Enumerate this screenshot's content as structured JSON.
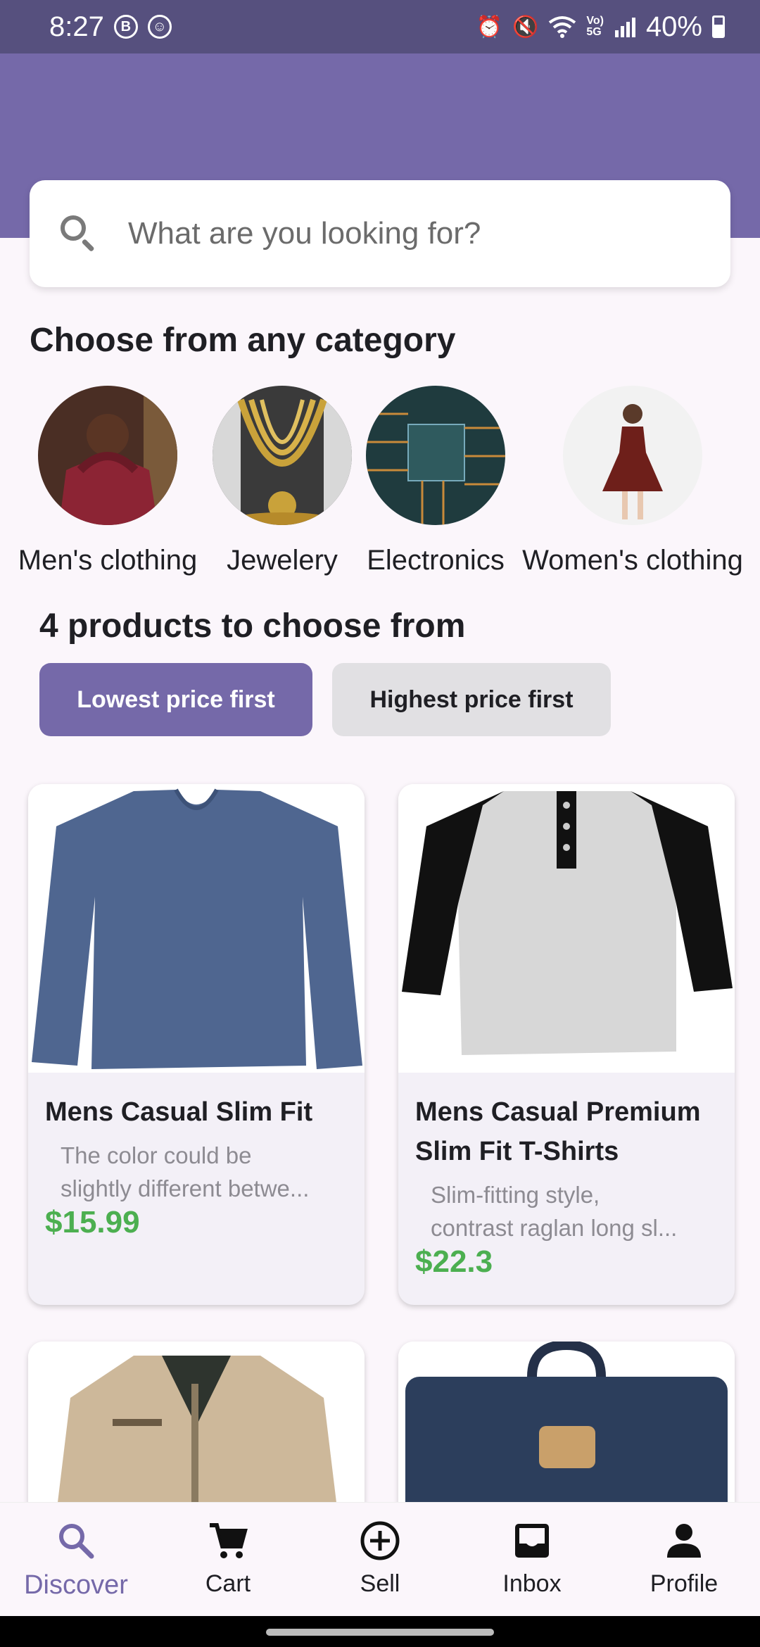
{
  "status_bar": {
    "time": "8:27",
    "b_badge": "B",
    "battery": "40%"
  },
  "search": {
    "placeholder": "What are you looking for?"
  },
  "categories": {
    "heading": "Choose from any category",
    "items": [
      {
        "label": "Men's clothing"
      },
      {
        "label": "Jewelery"
      },
      {
        "label": "Electronics"
      },
      {
        "label": "Women's clothing"
      }
    ]
  },
  "products": {
    "heading": "4 products to choose from",
    "sort_low": "Lowest price first",
    "sort_high": "Highest price first",
    "items": [
      {
        "title": "Mens Casual Slim Fit",
        "desc_line1": "The color could be",
        "desc_line2": "slightly different betwe...",
        "price": "$15.99"
      },
      {
        "title_line1": "Mens Casual Premium",
        "title_line2": "Slim Fit T-Shirts",
        "desc_line1": "Slim-fitting style,",
        "desc_line2": "contrast raglan long sl...",
        "price": "$22.3"
      }
    ]
  },
  "nav": {
    "items": [
      {
        "label": "Discover",
        "icon": "search-icon",
        "active": true
      },
      {
        "label": "Cart",
        "icon": "cart-icon"
      },
      {
        "label": "Sell",
        "icon": "plus-circle-icon"
      },
      {
        "label": "Inbox",
        "icon": "inbox-icon"
      },
      {
        "label": "Profile",
        "icon": "person-icon"
      }
    ]
  },
  "colors": {
    "primary": "#7569a9",
    "status_bar": "#56507e",
    "price": "#4caf50"
  }
}
